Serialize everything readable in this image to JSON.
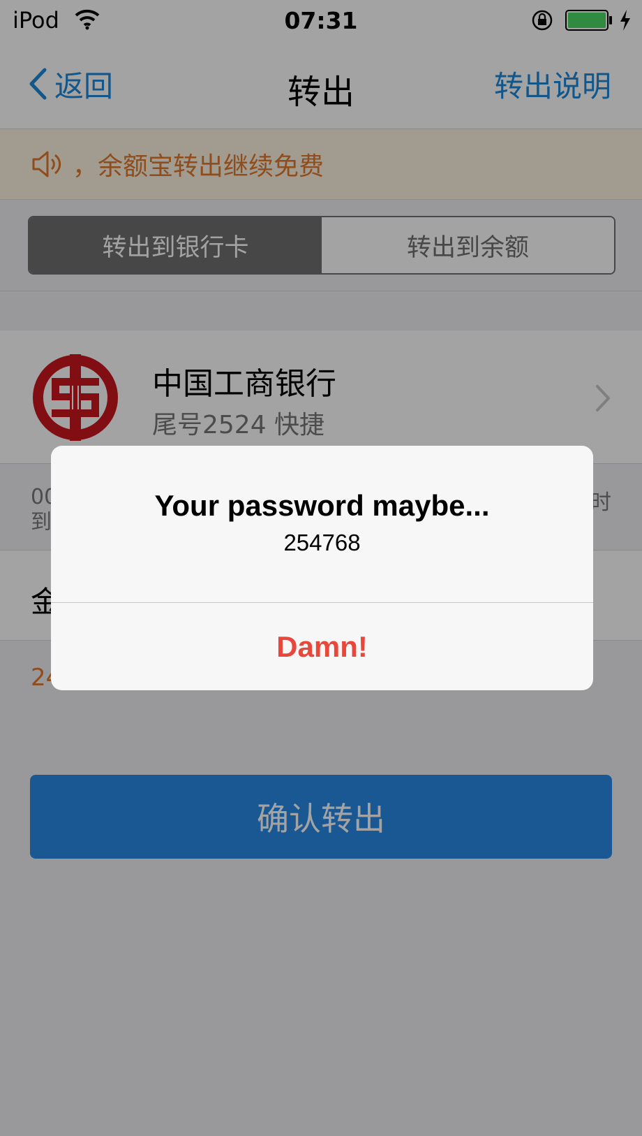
{
  "status_bar": {
    "carrier": "iPod",
    "time": "07:31",
    "battery_color": "#4cd964"
  },
  "nav": {
    "back_label": "返回",
    "title": "转出",
    "right_label": "转出说明"
  },
  "notice": {
    "text": "，余额宝转出继续免费"
  },
  "segments": [
    {
      "label": "转出到银行卡",
      "selected": true
    },
    {
      "label": "转出到余额",
      "selected": false
    }
  ],
  "bank": {
    "name": "中国工商银行",
    "subtitle": "尾号2524 快捷"
  },
  "info": {
    "line1": "00",
    "line2": "到",
    "right": "时"
  },
  "amount": {
    "label": "金"
  },
  "available": "24",
  "confirm_label": "确认转出",
  "alert": {
    "title": "Your password maybe...",
    "message": "254768",
    "button": "Damn!"
  },
  "colors": {
    "accent_blue": "#1e88d8",
    "button_blue": "#2a8ae6",
    "notice_orange": "#e0772c",
    "alert_red": "#e8473b",
    "icbc_red": "#c8161d"
  },
  "icons": [
    "wifi-icon",
    "rotation-lock-icon",
    "battery-icon",
    "charging-icon",
    "back-chevron-icon",
    "speaker-icon",
    "icbc-logo",
    "chevron-right-icon"
  ]
}
